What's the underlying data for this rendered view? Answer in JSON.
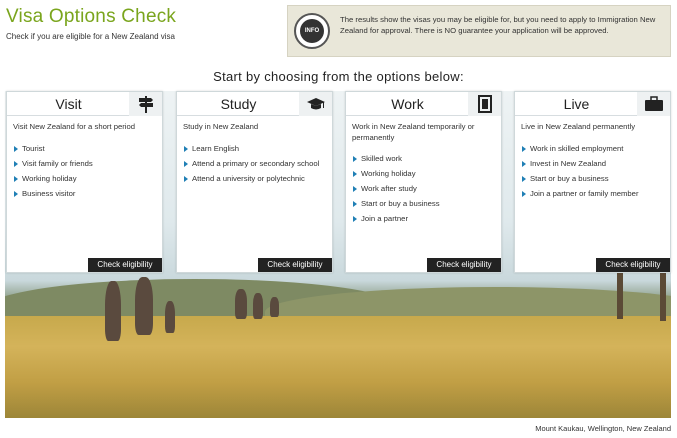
{
  "header": {
    "title": "Visa Options Check",
    "subtitle": "Check if you are eligible for a New Zealand visa"
  },
  "info": {
    "badge_label": "INFO",
    "text": "The results show the visas you may be eligible for, but you need to apply to Immigration New Zealand for approval. There is NO guarantee your application will be approved."
  },
  "prompt": "Start by choosing from the options below:",
  "cards": [
    {
      "title": "Visit",
      "icon": "signpost-icon",
      "description": "Visit New Zealand for a short period",
      "items": [
        "Tourist",
        "Visit family or friends",
        "Working holiday",
        "Business visitor"
      ],
      "button": "Check eligibility"
    },
    {
      "title": "Study",
      "icon": "graduation-cap-icon",
      "description": "Study in New Zealand",
      "items": [
        "Learn English",
        "Attend a primary or secondary school",
        "Attend a university or polytechnic"
      ],
      "button": "Check eligibility"
    },
    {
      "title": "Work",
      "icon": "notebook-icon",
      "description": "Work in New Zealand temporarily or permanently",
      "items": [
        "Skilled work",
        "Working holiday",
        "Work after study",
        "Start or buy a business",
        "Join a partner"
      ],
      "button": "Check eligibility"
    },
    {
      "title": "Live",
      "icon": "briefcase-icon",
      "description": "Live in New Zealand permanently",
      "items": [
        "Work in skilled employment",
        "Invest in New Zealand",
        "Start or buy a business",
        "Join a partner or family member"
      ],
      "button": "Check eligibility"
    }
  ],
  "caption": "Mount Kaukau, Wellington, New Zealand"
}
